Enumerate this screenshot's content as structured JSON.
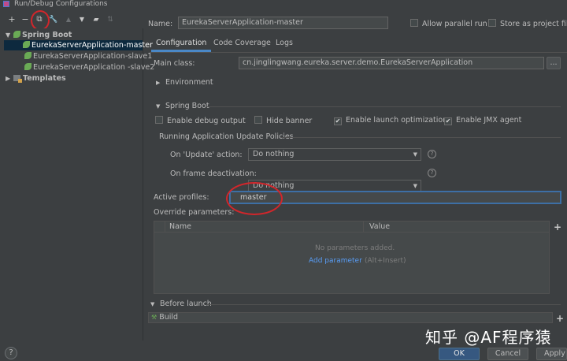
{
  "window": {
    "title": "Run/Debug Configurations"
  },
  "toolbar": {
    "add": "+",
    "remove": "−",
    "copy": "⧉",
    "edit": "🔧",
    "up": "▲",
    "down": "▼",
    "folder": "▰",
    "sort": "⇅"
  },
  "tree": {
    "group_label": "Spring Boot",
    "items": [
      {
        "label": "EurekaServerApplication-master"
      },
      {
        "label": "EurekaServerApplication-slave1"
      },
      {
        "label": "EurekaServerApplication -slave2"
      }
    ],
    "templates_label": "Templates"
  },
  "name_row": {
    "label": "Name:",
    "value": "EurekaServerApplication-master",
    "allow_parallel_label": "Allow parallel run",
    "store_as_project_label": "Store as project file"
  },
  "tabs": [
    {
      "label": "Configuration"
    },
    {
      "label": "Code Coverage"
    },
    {
      "label": "Logs"
    }
  ],
  "main_class": {
    "label": "Main class:",
    "value": "cn.jinglingwang.eureka.server.demo.EurekaServerApplication",
    "browse": "..."
  },
  "environment": {
    "label": "Environment"
  },
  "spring_boot": {
    "label": "Spring Boot",
    "enable_debug_label": "Enable debug output",
    "hide_banner_label": "Hide banner",
    "launch_opt_label": "Enable launch optimization",
    "jmx_label": "Enable JMX agent"
  },
  "update_policies": {
    "label": "Running Application Update Policies",
    "on_update_label": "On 'Update' action:",
    "on_update_value": "Do nothing",
    "on_frame_label": "On frame deactivation:",
    "on_frame_value": "Do nothing",
    "help": "?"
  },
  "active_profiles": {
    "label": "Active profiles:",
    "value": "master"
  },
  "override_params": {
    "label": "Override parameters:",
    "col_name": "Name",
    "col_value": "Value",
    "empty_text": "No parameters added.",
    "add_link": "Add parameter",
    "add_hint": "(Alt+Insert)",
    "plus": "+"
  },
  "before_launch": {
    "label": "Before launch",
    "build_label": "Build",
    "plus": "+"
  },
  "buttons": {
    "ok": "OK",
    "cancel": "Cancel",
    "apply": "Apply",
    "help": "?"
  },
  "watermark": {
    "text": "知乎 @AF程序猿"
  },
  "colors": {
    "accent": "#4a88c7",
    "annotation_red": "#d2262b",
    "selection": "#0d293e",
    "link": "#589df6"
  }
}
